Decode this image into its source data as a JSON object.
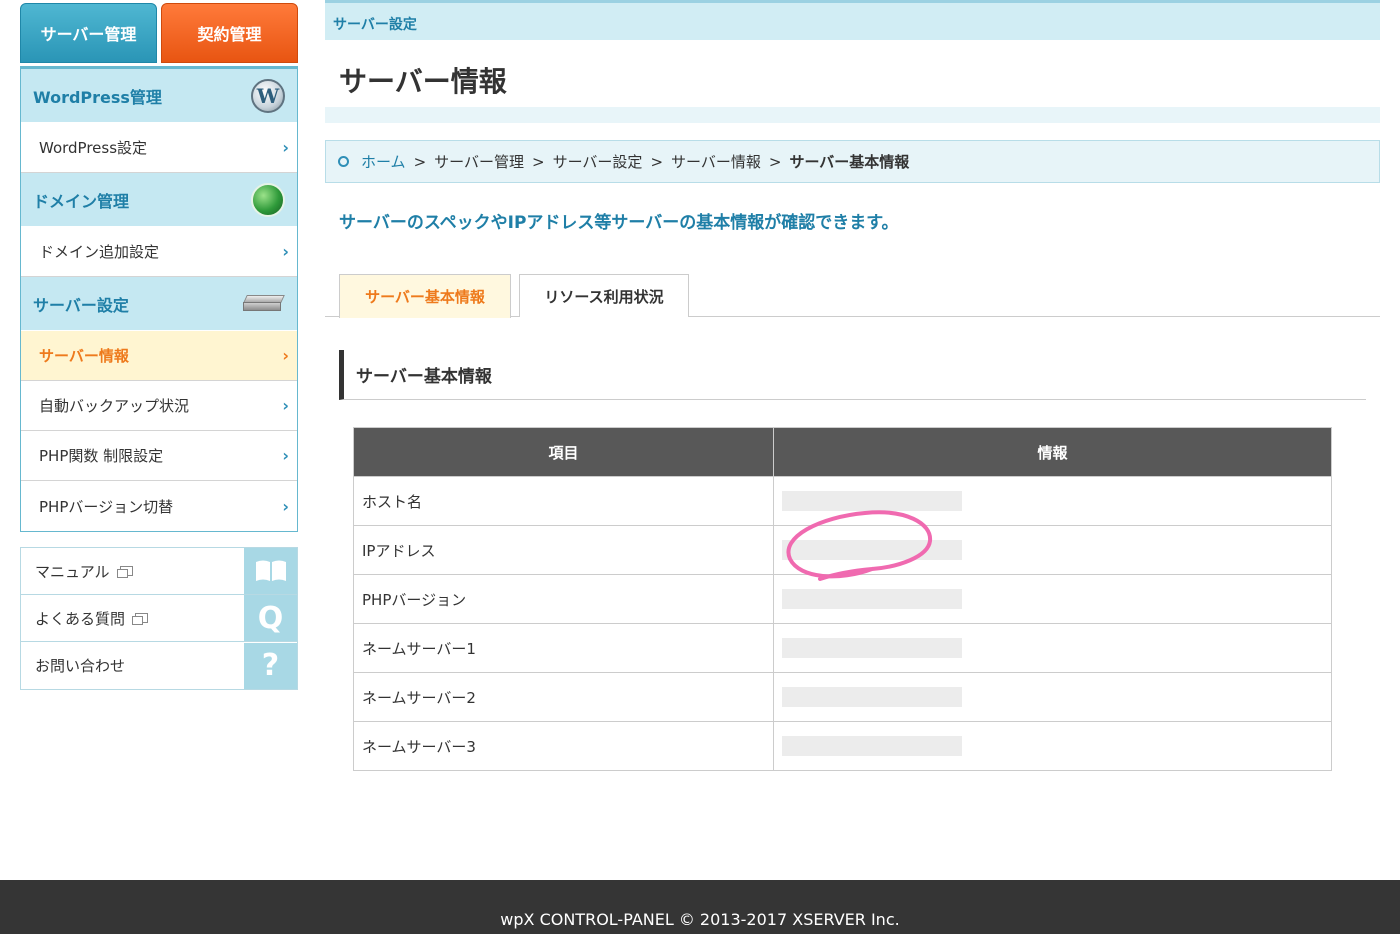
{
  "sidebar": {
    "tab_server": "サーバー管理",
    "tab_contract": "契約管理",
    "sections": {
      "wordpress": "WordPress管理",
      "domain": "ドメイン管理",
      "server": "サーバー設定"
    },
    "items": {
      "wp_settings": "WordPress設定",
      "domain_add": "ドメイン追加設定",
      "server_info": "サーバー情報",
      "backup": "自動バックアップ状況",
      "php_limits": "PHP関数 制限設定",
      "php_version": "PHPバージョン切替"
    },
    "chevron": "›",
    "help": {
      "manual": "マニュアル",
      "faq": "よくある質問",
      "contact": "お問い合わせ",
      "faq_glyph": "Q",
      "contact_glyph": "?"
    }
  },
  "header": {
    "section_label": "サーバー設定",
    "page_title": "サーバー情報"
  },
  "breadcrumb": {
    "home": "ホーム",
    "sep": ">",
    "items": [
      "サーバー管理",
      "サーバー設定",
      "サーバー情報"
    ],
    "current": "サーバー基本情報"
  },
  "lead": "サーバーのスペックやIPアドレス等サーバーの基本情報が確認できます。",
  "tabs": {
    "basic": "サーバー基本情報",
    "resource": "リソース利用状況"
  },
  "section_title": "サーバー基本情報",
  "table": {
    "headers": [
      "項目",
      "情報"
    ],
    "rows": [
      "ホスト名",
      "IPアドレス",
      "PHPバージョン",
      "ネームサーバー1",
      "ネームサーバー2",
      "ネームサーバー3"
    ]
  },
  "colors": {
    "accent_blue": "#1f7fa7",
    "accent_orange": "#ee7a1c",
    "annotation_pink": "#f06ab0"
  },
  "footer": "wpX CONTROL-PANEL © 2013-2017 XSERVER Inc."
}
